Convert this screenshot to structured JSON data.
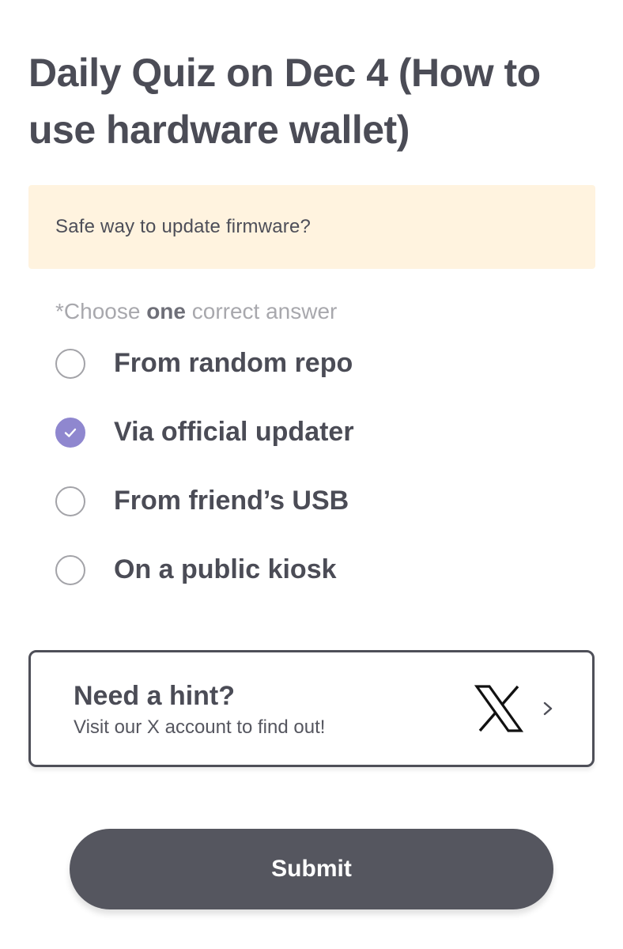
{
  "quiz": {
    "title": "Daily Quiz on Dec 4 (How to use hardware wallet)",
    "question": "Safe way to update firmware?",
    "instruction_prefix": "*Choose ",
    "instruction_emphasis": "one",
    "instruction_suffix": " correct answer",
    "options": [
      {
        "label": "From random repo",
        "selected": false
      },
      {
        "label": "Via official updater",
        "selected": true
      },
      {
        "label": "From friend’s USB",
        "selected": false
      },
      {
        "label": "On a public kiosk",
        "selected": false
      }
    ]
  },
  "hint": {
    "title": "Need a hint?",
    "subtitle": "Visit our X account to find out!",
    "icon": "x-logo-icon"
  },
  "submit": {
    "label": "Submit"
  },
  "colors": {
    "accent": "#8f87cf",
    "question_bg": "#fff3df",
    "button_bg": "#55565f"
  }
}
